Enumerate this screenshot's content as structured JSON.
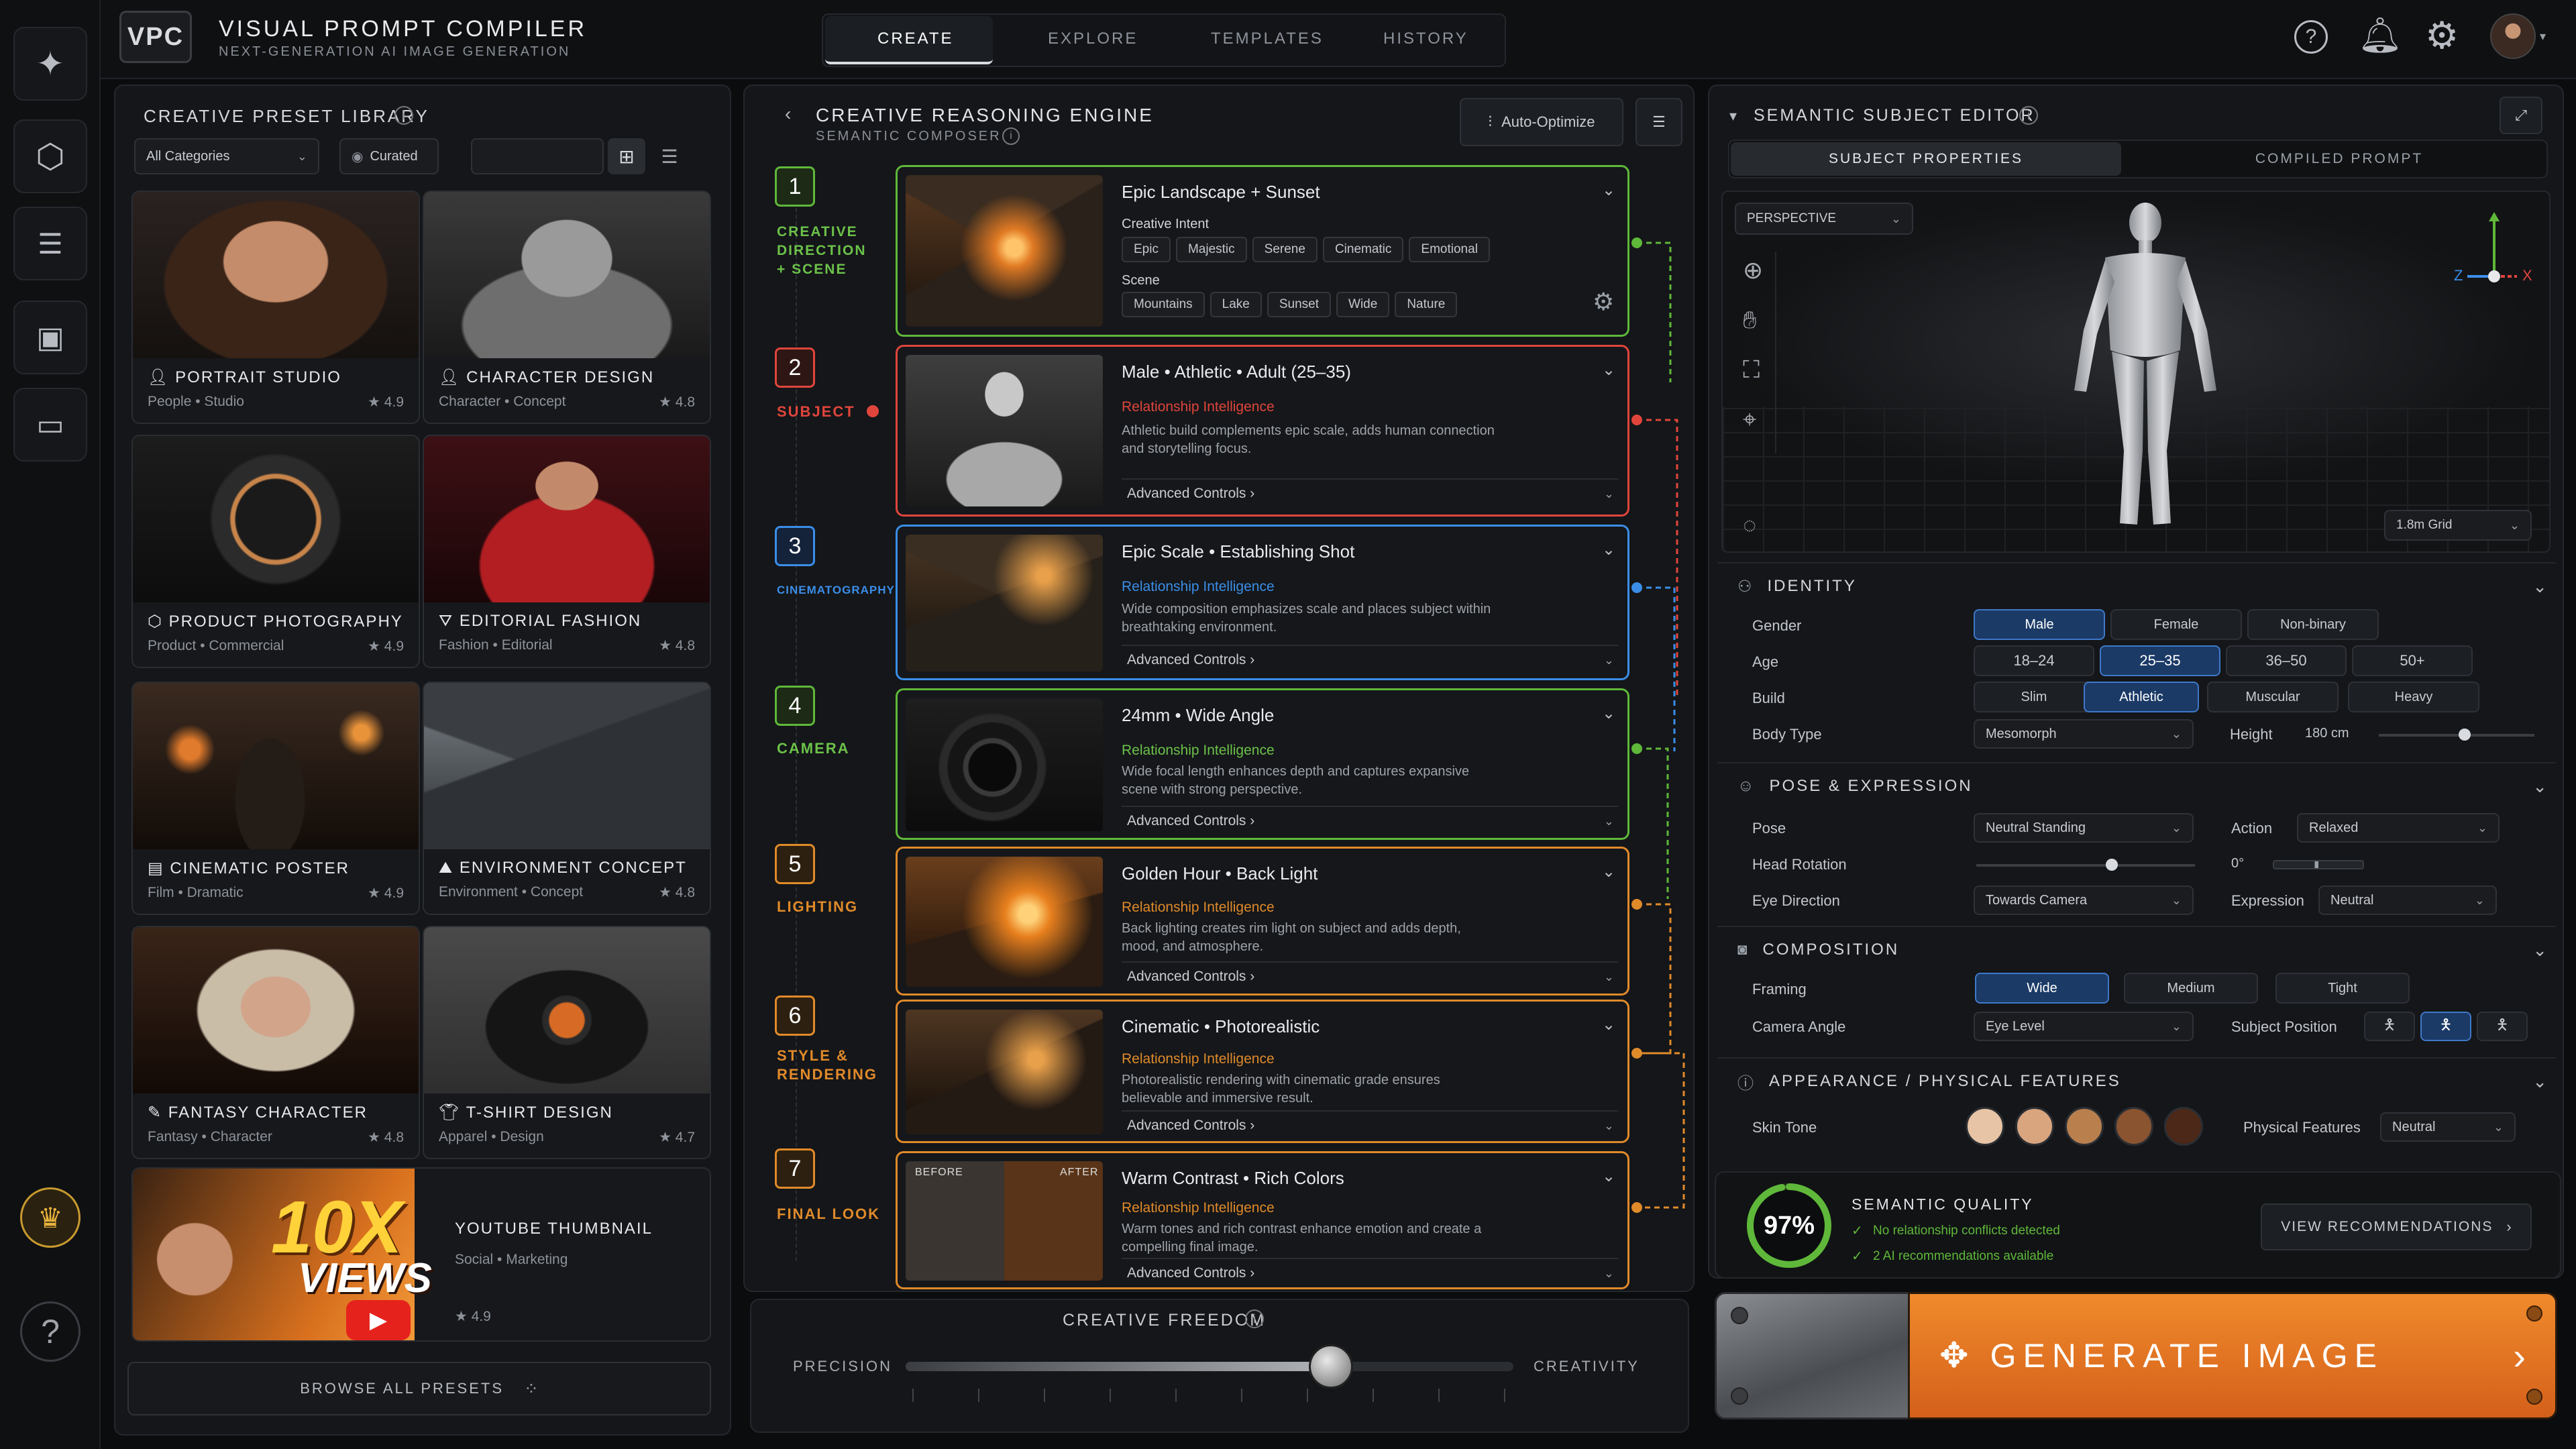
{
  "app": {
    "logo": "VPC",
    "title": "VISUAL PROMPT COMPILER",
    "subtitle": "NEXT-GENERATION AI IMAGE GENERATION"
  },
  "nav": {
    "tabs": [
      "CREATE",
      "EXPLORE",
      "TEMPLATES",
      "HISTORY"
    ],
    "active": "CREATE"
  },
  "icons": {
    "help": "help-icon",
    "bell": "bell-icon",
    "gear": "gear-icon",
    "avatar": "avatar"
  },
  "library": {
    "title": "CREATIVE PRESET LIBRARY",
    "filter": "All Categories",
    "curated": "Curated",
    "browse": "BROWSE ALL PRESETS",
    "presets": [
      {
        "name": "PORTRAIT STUDIO",
        "tags": "People  •  Studio",
        "rating": "★ 4.9"
      },
      {
        "name": "CHARACTER DESIGN",
        "tags": "Character  •  Concept",
        "rating": "★ 4.8"
      },
      {
        "name": "PRODUCT PHOTOGRAPHY",
        "tags": "Product  •  Commercial",
        "rating": "★ 4.9"
      },
      {
        "name": "EDITORIAL FASHION",
        "tags": "Fashion  •  Editorial",
        "rating": "★ 4.8"
      },
      {
        "name": "CINEMATIC POSTER",
        "tags": "Film  •  Dramatic",
        "rating": "★ 4.9"
      },
      {
        "name": "ENVIRONMENT CONCEPT",
        "tags": "Environment  •  Concept",
        "rating": "★ 4.8"
      },
      {
        "name": "FANTASY CHARACTER",
        "tags": "Fantasy  •  Character",
        "rating": "★ 4.8"
      },
      {
        "name": "T-SHIRT DESIGN",
        "tags": "Apparel  •  Design",
        "rating": "★ 4.7"
      }
    ],
    "youtube": {
      "name": "YOUTUBE THUMBNAIL",
      "tags": "Social  •  Marketing",
      "rating": "★ 4.9",
      "art1": "10X",
      "art2": "VIEWS"
    }
  },
  "engine": {
    "title": "CREATIVE REASONING ENGINE",
    "subtitle": "SEMANTIC COMPOSER",
    "auto": "Auto-Optimize",
    "ri_label": "Relationship Intelligence",
    "adv_label": "Advanced Controls",
    "steps": [
      {
        "num": "1",
        "label": "CREATIVE DIRECTION + SCENE",
        "title": "Epic Landscape  +  Sunset",
        "intent_label": "Creative Intent",
        "intent": [
          "Epic",
          "Majestic",
          "Serene",
          "Cinematic",
          "Emotional"
        ],
        "scene_label": "Scene",
        "scene": [
          "Mountains",
          "Lake",
          "Sunset",
          "Wide",
          "Nature"
        ]
      },
      {
        "num": "2",
        "label": "SUBJECT",
        "title": "Male  •  Athletic  •  Adult (25–35)",
        "desc": "Athletic build complements epic scale, adds human connection and storytelling focus."
      },
      {
        "num": "3",
        "label": "CINEMATOGRAPHY",
        "title": "Epic Scale  •  Establishing Shot",
        "desc": "Wide composition emphasizes scale and places subject within breathtaking environment."
      },
      {
        "num": "4",
        "label": "CAMERA",
        "title": "24mm  •  Wide Angle",
        "desc": "Wide focal length enhances depth and captures expansive scene with strong perspective."
      },
      {
        "num": "5",
        "label": "LIGHTING",
        "title": "Golden Hour  •  Back Light",
        "desc": "Back lighting creates rim light on subject and adds depth, mood, and atmosphere."
      },
      {
        "num": "6",
        "label": "STYLE & RENDERING",
        "title": "Cinematic  •  Photorealistic",
        "desc": "Photorealistic rendering with cinematic grade ensures believable and immersive result."
      },
      {
        "num": "7",
        "label": "FINAL LOOK",
        "title": "Warm Contrast  •  Rich Colors",
        "desc": "Warm tones and rich contrast enhance emotion and create a compelling final image.",
        "before": "BEFORE",
        "after": "AFTER"
      }
    ],
    "freedom": {
      "title": "CREATIVE FREEDOM",
      "left": "PRECISION",
      "right": "CREATIVITY",
      "value": 0.7
    }
  },
  "editor": {
    "title": "SEMANTIC SUBJECT EDITOR",
    "tabs": [
      "SUBJECT PROPERTIES",
      "COMPILED PROMPT"
    ],
    "perspective": "PERSPECTIVE",
    "grid": "1.8m Grid",
    "axes": {
      "z": "Z",
      "x": "X"
    },
    "identity": {
      "title": "IDENTITY",
      "gender_label": "Gender",
      "gender": [
        "Male",
        "Female",
        "Non-binary"
      ],
      "gender_sel": "Male",
      "age_label": "Age",
      "age": [
        "18–24",
        "25–35",
        "36–50",
        "50+"
      ],
      "age_sel": "25–35",
      "build_label": "Build",
      "build": [
        "Slim",
        "Athletic",
        "Muscular",
        "Heavy"
      ],
      "build_sel": "Athletic",
      "body_label": "Body Type",
      "body": "Mesomorph",
      "height_label": "Height",
      "height": "180 cm",
      "height_val": 0.55
    },
    "pose": {
      "title": "POSE & EXPRESSION",
      "pose_label": "Pose",
      "pose": "Neutral Standing",
      "action_label": "Action",
      "action": "Relaxed",
      "head_label": "Head Rotation",
      "head_deg": "0°",
      "head_val": 0.62,
      "eye_label": "Eye Direction",
      "eye": "Towards Camera",
      "expr_label": "Expression",
      "expr": "Neutral"
    },
    "composition": {
      "title": "COMPOSITION",
      "framing_label": "Framing",
      "framing": [
        "Wide",
        "Medium",
        "Tight"
      ],
      "framing_sel": "Wide",
      "angle_label": "Camera Angle",
      "angle": "Eye Level",
      "position_label": "Subject Position"
    },
    "appearance": {
      "title": "APPEARANCE / PHYSICAL FEATURES",
      "skin_label": "Skin Tone",
      "skins": [
        "#e8c4a6",
        "#d9a57f",
        "#b9804e",
        "#8a5430",
        "#4c2818"
      ],
      "features_label": "Physical Features",
      "features": "Neutral"
    },
    "quality": {
      "percent": "97%",
      "value": 0.97,
      "title": "SEMANTIC QUALITY",
      "line1": "No relationship conflicts detected",
      "line2": "2 AI recommendations available",
      "button": "VIEW RECOMMENDATIONS"
    },
    "generate": "GENERATE IMAGE"
  },
  "colors": {
    "green": "#5fb83a",
    "red": "#e0453c",
    "blue": "#3b8ee8",
    "orange": "#e08a2a",
    "accent": "#e8701e"
  }
}
